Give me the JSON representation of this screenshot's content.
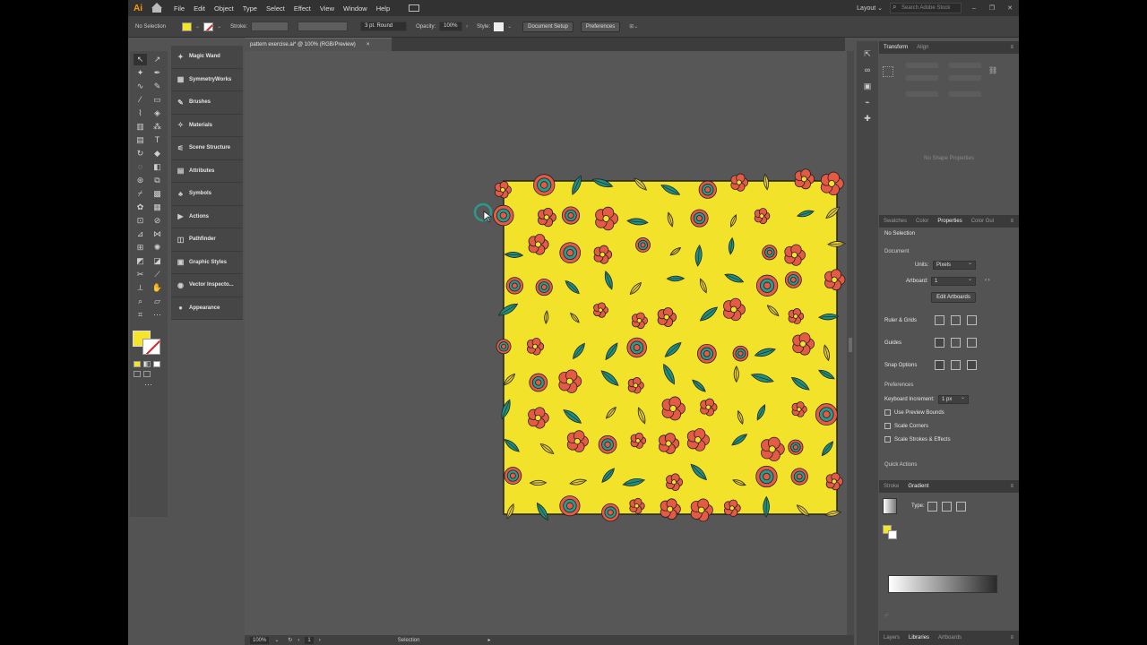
{
  "app": {
    "logo": "Ai",
    "menus": [
      "File",
      "Edit",
      "Object",
      "Type",
      "Select",
      "Effect",
      "View",
      "Window",
      "Help"
    ],
    "workspace": "Layout",
    "search_placeholder": "Search Adobe Stock"
  },
  "controlbar": {
    "selection": "No Selection",
    "stroke_label": "Stroke:",
    "stroke_profile": "3 pt. Round",
    "opacity_label": "Opacity:",
    "opacity_value": "100%",
    "style_label": "Style:",
    "document_setup": "Document Setup",
    "preferences": "Preferences"
  },
  "document": {
    "tab_title": "pattern exercise.ai* @ 100% (RGB/Preview)",
    "tab_close": "×"
  },
  "dock": {
    "items": [
      {
        "label": "Magic Wand",
        "icon": "magic-wand-icon",
        "glyph": "✦"
      },
      {
        "label": "SymmetryWorks",
        "icon": "symmetry-icon",
        "glyph": "▦"
      },
      {
        "label": "Brushes",
        "icon": "brush-icon",
        "glyph": "✎"
      },
      {
        "label": "Materials",
        "icon": "materials-icon",
        "glyph": "✧"
      },
      {
        "label": "Scene Structure",
        "icon": "scene-icon",
        "glyph": "⚟"
      },
      {
        "label": "Attributes",
        "icon": "attributes-icon",
        "glyph": "▤"
      },
      {
        "label": "Symbols",
        "icon": "symbols-icon",
        "glyph": "♣"
      },
      {
        "label": "Actions",
        "icon": "actions-icon",
        "glyph": "▶"
      },
      {
        "label": "Pathfinder",
        "icon": "pathfinder-icon",
        "glyph": "◫"
      },
      {
        "label": "Graphic Styles",
        "icon": "graphic-styles-icon",
        "glyph": "▣"
      },
      {
        "label": "Vector Inspecto...",
        "icon": "eye-icon",
        "glyph": "◉"
      },
      {
        "label": "Appearance",
        "icon": "appearance-icon",
        "glyph": "●"
      }
    ]
  },
  "statusbar": {
    "zoom": "100%",
    "artboard": "1",
    "mode": "Selection"
  },
  "panels": {
    "top_tabs": [
      "Transform",
      "Align"
    ],
    "no_shape": "No Shape Properties",
    "mid_tabs": [
      "Swatches",
      "Color",
      "Properties",
      "Color Gui"
    ],
    "properties": {
      "selection": "No Selection",
      "document_heading": "Document",
      "units_label": "Units:",
      "units_value": "Pixels",
      "artboard_label": "Artboard:",
      "artboard_value": "1",
      "edit_artboards": "Edit Artboards",
      "rulers_grids": "Ruler & Grids",
      "guides": "Guides",
      "snap_options": "Snap Options",
      "preferences_heading": "Preferences",
      "keyboard_increment_label": "Keyboard Increment:",
      "keyboard_increment_value": "1 px",
      "use_preview_bounds": "Use Preview Bounds",
      "scale_corners": "Scale Corners",
      "scale_strokes": "Scale Strokes & Effects",
      "quick_actions": "Quick Actions"
    },
    "bottom_tabs": [
      "Stroke",
      "Gradient"
    ],
    "gradient_type_label": "Type:",
    "footer_tabs": [
      "Layers",
      "Libraries",
      "Artboards"
    ]
  },
  "artwork": {
    "background": "#f2e22a",
    "flower_red": "#e65a45",
    "flower_teal": "#2a9a8c",
    "leaf_teal": "#1f8f80",
    "leaf_yellow": "#e3c83a"
  }
}
